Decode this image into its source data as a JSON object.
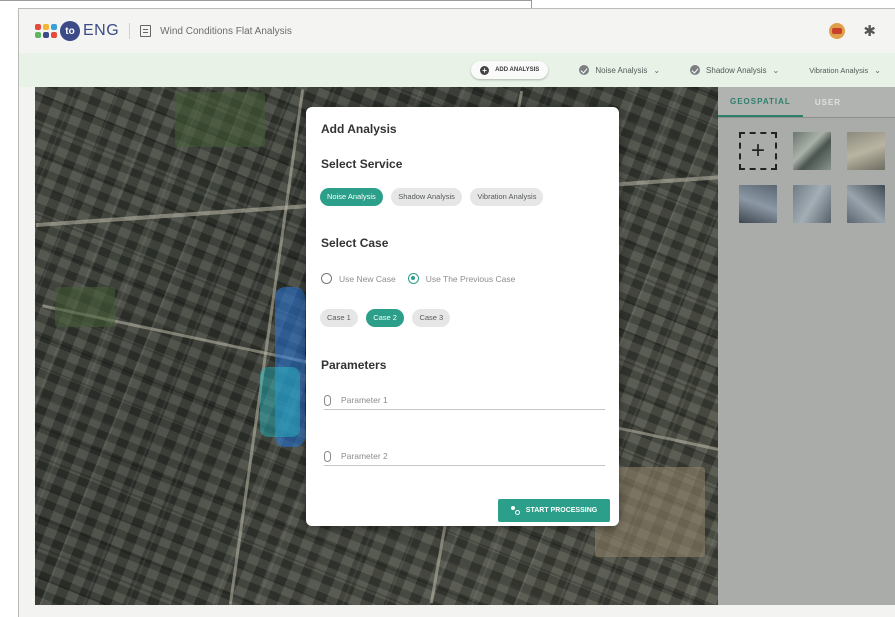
{
  "app": {
    "logo_text": "ENG",
    "logo_badge": "to",
    "project_title": "Wind Conditions Flat Analysis"
  },
  "toolbar": {
    "add_analysis_label": "ADD ANALYSIS",
    "items": [
      {
        "label": "Noise Analysis"
      },
      {
        "label": "Shadow Analysis"
      },
      {
        "label": "Vibration Analysis"
      }
    ]
  },
  "sidepanel": {
    "tabs": [
      {
        "label": "GEOSPATIAL",
        "active": true
      },
      {
        "label": "USER",
        "active": false
      }
    ],
    "add_symbol": "+"
  },
  "modal": {
    "title": "Add Analysis",
    "select_service_title": "Select Service",
    "services": [
      {
        "label": "Noise Analysis",
        "selected": true
      },
      {
        "label": "Shadow Analysis",
        "selected": false
      },
      {
        "label": "Vibration Analysis",
        "selected": false
      }
    ],
    "select_case_title": "Select Case",
    "case_options": [
      {
        "label": "Use New Case",
        "checked": false
      },
      {
        "label": "Use The Previous Case",
        "checked": true
      }
    ],
    "cases": [
      {
        "label": "Case 1",
        "selected": false
      },
      {
        "label": "Case 2",
        "selected": true
      },
      {
        "label": "Case 3",
        "selected": false
      }
    ],
    "parameters_title": "Parameters",
    "param1_placeholder": "Parameter 1",
    "param2_placeholder": "Parameter 2",
    "start_label": "START PROCESSING"
  },
  "colors": {
    "accent": "#2c9f8a",
    "toolbar_bg": "#e8f2e6",
    "logo": "#3c4b88"
  }
}
